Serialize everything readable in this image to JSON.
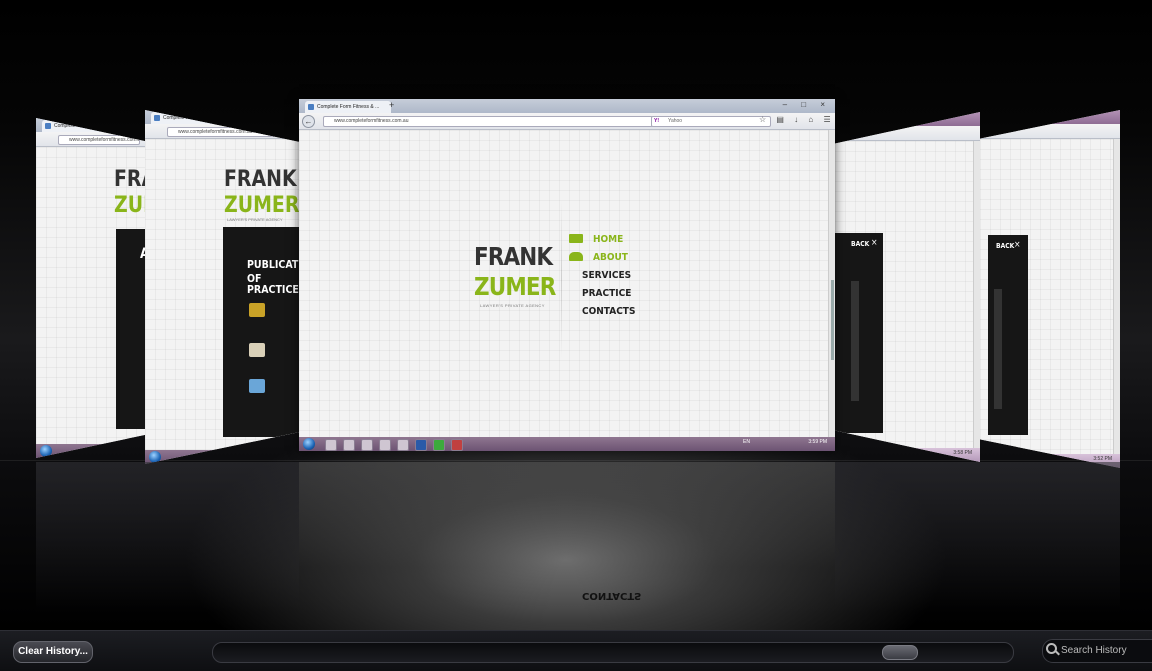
{
  "main_window": {
    "tab_title": "Complete Form Fitness & ...",
    "new_tab": "+",
    "window_controls": "– □ ×",
    "back": "←",
    "url": "www.completeformfitness.com.au",
    "search_engine": "Yahoo",
    "toolbar_icons": "☆ ▤ ↓ ⌂ ☰",
    "logo_line1": "FRANK",
    "logo_line2": "ZUMER",
    "tagline": "LAWYER'S PRIVATE AGENCY",
    "menu": [
      {
        "label": "HOME",
        "active": true
      },
      {
        "label": "ABOUT",
        "active": true
      },
      {
        "label": "SERVICES",
        "active": false
      },
      {
        "label": "PRACTICE",
        "active": false
      },
      {
        "label": "CONTACTS",
        "active": false
      }
    ],
    "tray_lang": "EN",
    "tray_time": "3:59 PM"
  },
  "left_window_2": {
    "tab_title": "Complete Form Fitness & ...",
    "url": "www.completeformfitness.com.au",
    "logo_line1": "FRANK",
    "logo_line2": "ZUMER",
    "tagline": "LAWYER'S PRIVATE AGENCY",
    "heading_line1": "PUBLICATION",
    "heading_line2": "OF PRACTICE"
  },
  "left_window_1": {
    "tab_title": "Complete Form Fitness &",
    "url": "www.completeformfitness.com.au",
    "logo_line1": "FRANK",
    "logo_line2": "ZUMER",
    "panel_letter": "A"
  },
  "right_window_1": {
    "panel_title": "BACK",
    "close": "×",
    "tray_time": "3:58 PM"
  },
  "right_window_2": {
    "panel_title": "BACK",
    "close": "×",
    "tray_time": "3:52 PM"
  },
  "reflection_text": "CONTACTS",
  "bottom_bar": {
    "clear_history_label": "Clear History...",
    "scroll_position": 0.88,
    "search_placeholder": "Search History"
  }
}
